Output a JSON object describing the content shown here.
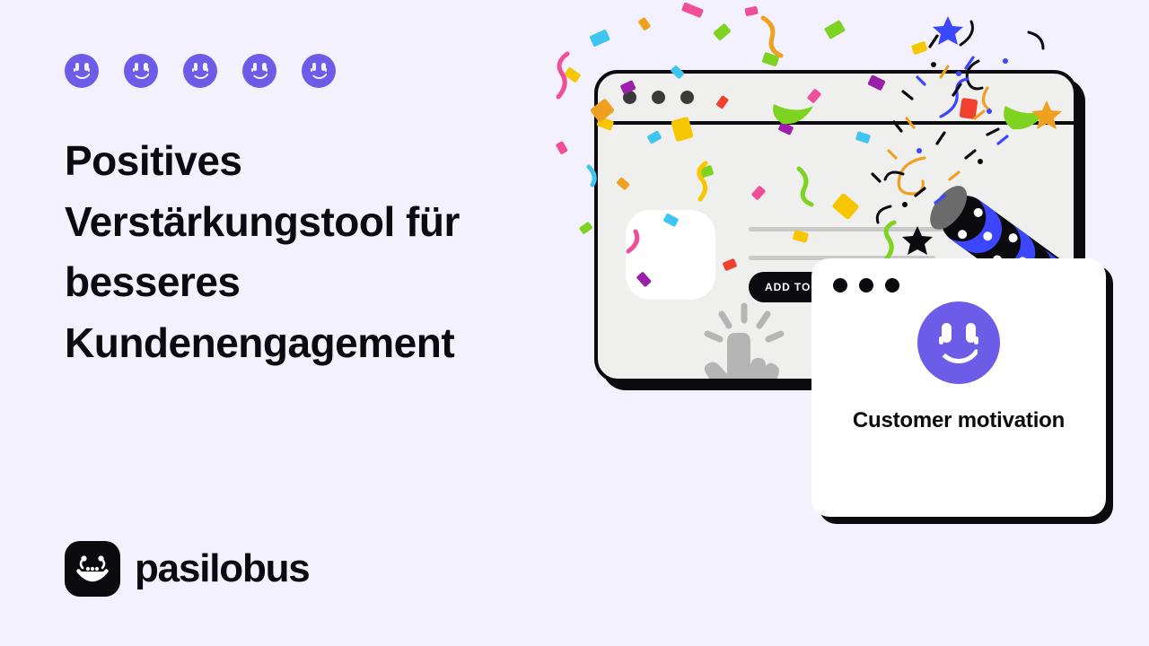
{
  "page": {
    "background_color": "#F2F1FD",
    "accent_color": "#6C5CE7",
    "ink_color": "#0B0B0F"
  },
  "hero": {
    "rating_icons": [
      "smiley-face-icon",
      "smiley-face-icon",
      "smiley-face-icon",
      "smiley-face-icon",
      "smiley-face-icon"
    ],
    "headline": "Positives Verstärkungstool für besseres Kundenengagement"
  },
  "brand": {
    "logo_icon": "pasilobus-laughing-face-logo",
    "name": "pasilobus"
  },
  "illustration": {
    "browser": {
      "window_dots": [
        "dot",
        "dot",
        "dot"
      ],
      "product_thumbnail": "product-image-placeholder",
      "placeholder_lines": [
        "line-long",
        "line-short"
      ],
      "add_to_cart_label": "ADD TO CART",
      "cursor_icon": "pointing-hand-cursor-icon",
      "party_popper_icon": "party-popper-icon",
      "confetti": "confetti-burst"
    },
    "motivation_card": {
      "window_dots": [
        "dot",
        "dot",
        "dot"
      ],
      "face_icon": "smiley-face-icon",
      "title": "Customer motivation"
    }
  }
}
